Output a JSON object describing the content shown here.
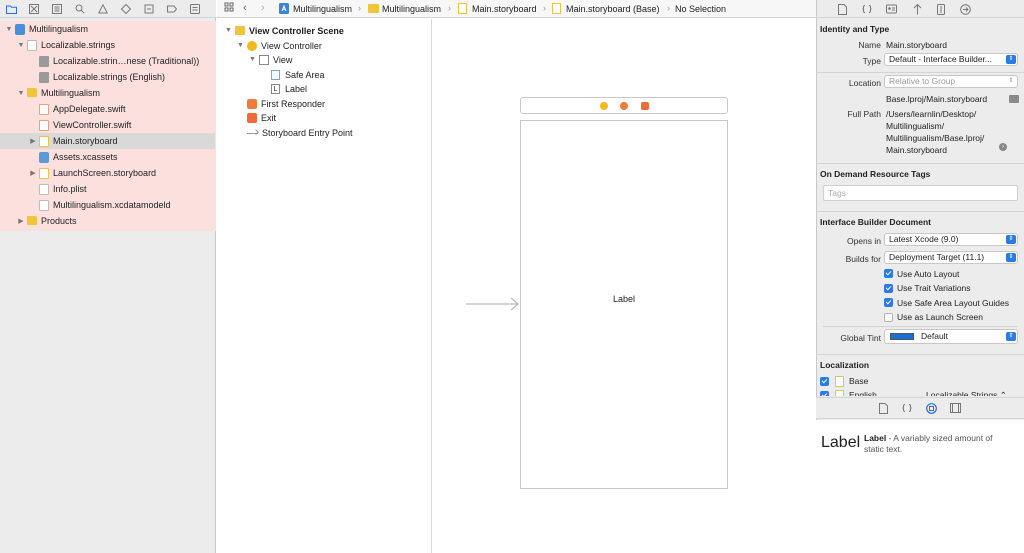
{
  "navigator": {
    "tabs": [
      "folder-icon",
      "source-control-icon",
      "symbol-icon",
      "find-icon",
      "issue-icon",
      "test-icon",
      "debug-icon",
      "breakpoint-icon",
      "report-icon"
    ],
    "tree": [
      {
        "label": "Multilingualism",
        "depth": 0,
        "disclosure": "open",
        "icon": "project"
      },
      {
        "label": "Localizable.strings",
        "depth": 1,
        "disclosure": "open",
        "icon": "strings"
      },
      {
        "label": "Localizable.strin…nese (Traditional))",
        "depth": 2,
        "disclosure": "",
        "icon": "strings-gray"
      },
      {
        "label": "Localizable.strings (English)",
        "depth": 2,
        "disclosure": "",
        "icon": "strings-gray"
      },
      {
        "label": "Multilingualism",
        "depth": 1,
        "disclosure": "open",
        "icon": "folder"
      },
      {
        "label": "AppDelegate.swift",
        "depth": 2,
        "disclosure": "",
        "icon": "swift"
      },
      {
        "label": "ViewController.swift",
        "depth": 2,
        "disclosure": "",
        "icon": "swift"
      },
      {
        "label": "Main.storyboard",
        "depth": 2,
        "disclosure": "closed",
        "icon": "storyboard",
        "selected": true
      },
      {
        "label": "Assets.xcassets",
        "depth": 2,
        "disclosure": "",
        "icon": "assets"
      },
      {
        "label": "LaunchScreen.storyboard",
        "depth": 2,
        "disclosure": "closed",
        "icon": "storyboard"
      },
      {
        "label": "Info.plist",
        "depth": 2,
        "disclosure": "",
        "icon": "file"
      },
      {
        "label": "Multilingualism.xcdatamodeld",
        "depth": 2,
        "disclosure": "",
        "icon": "file"
      },
      {
        "label": "Products",
        "depth": 1,
        "disclosure": "closed",
        "icon": "folder"
      }
    ]
  },
  "jumpbar": {
    "crumbs": [
      "Multilingualism",
      "Multilingualism",
      "Main.storyboard",
      "Main.storyboard (Base)",
      "No Selection"
    ]
  },
  "outline": {
    "rows": [
      {
        "label": "View Controller Scene",
        "depth": 0,
        "bold": true
      },
      {
        "label": "View Controller",
        "depth": 1
      },
      {
        "label": "View",
        "depth": 2
      },
      {
        "label": "Safe Area",
        "depth": 3
      },
      {
        "label": "Label",
        "depth": 3
      },
      {
        "label": "First Responder",
        "depth": 1
      },
      {
        "label": "Exit",
        "depth": 1
      },
      {
        "label": "Storyboard Entry Point",
        "depth": 1
      }
    ]
  },
  "canvas": {
    "scene_label": "Label"
  },
  "inspector": {
    "tabs": [
      "file-icon",
      "quick-help-icon",
      "identity-icon",
      "attributes-icon",
      "size-icon",
      "connections-icon"
    ],
    "identity": {
      "header": "Identity and Type",
      "name_key": "Name",
      "name_value": "Main.storyboard",
      "type_key": "Type",
      "type_value": "Default - Interface Builder...",
      "location_key": "Location",
      "location_value": "Relative to Group",
      "location_path": "Base.lproj/Main.storyboard",
      "fullpath_key": "Full Path",
      "fullpath_lines": [
        "/Users/learnlin/Desktop/",
        "Multilingualism/",
        "Multilingualism/Base.lproj/",
        "Main.storyboard"
      ]
    },
    "ondemand": {
      "header": "On Demand Resource Tags",
      "placeholder": "Tags"
    },
    "ibdoc": {
      "header": "Interface Builder Document",
      "opens_key": "Opens in",
      "opens_value": "Latest Xcode (9.0)",
      "builds_key": "Builds for",
      "builds_value": "Deployment Target (11.1)",
      "checks": [
        {
          "label": "Use Auto Layout",
          "checked": true
        },
        {
          "label": "Use Trait Variations",
          "checked": true
        },
        {
          "label": "Use Safe Area Layout Guides",
          "checked": true
        },
        {
          "label": "Use as Launch Screen",
          "checked": false
        }
      ],
      "tint_key": "Global Tint",
      "tint_value": "Default",
      "tint_color": "#1a6fd1"
    },
    "localization": {
      "header": "Localization",
      "rows": [
        {
          "label": "Base",
          "checked": true,
          "value": ""
        },
        {
          "label": "English",
          "checked": true,
          "value": "Localizable Strings"
        }
      ]
    },
    "library": {
      "tabs": [
        "file-template-icon",
        "code-snippet-icon",
        "object-library-icon",
        "media-library-icon"
      ],
      "preview": "Label",
      "title": "Label",
      "description": " - A variably sized amount of static text."
    }
  }
}
